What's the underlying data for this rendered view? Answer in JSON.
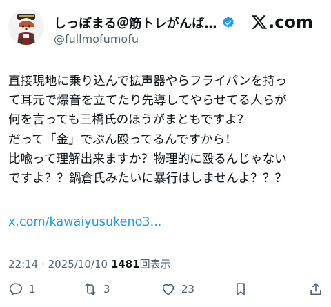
{
  "header": {
    "display_name": "しっぽまる＠筋トレがんば…",
    "handle": "@fullmofumofu",
    "brand": ".com",
    "verified_icon": "verified-badge-icon",
    "brand_icon": "x-logo-icon"
  },
  "post": {
    "lines": [
      "直接現地に乗り込んで拡声器やらフライパンを持っ",
      "て耳元で爆音を立てたり先導してやらせてる人らが",
      "何を言っても三橋氏のほうがまともですよ？",
      "だって「金」でぶん殴ってるんですから！",
      "比喩って理解出来ますか？物理的に殴るんじゃない",
      "ですよ？？鍋倉氏みたいに暴行はしませんよ？？？"
    ],
    "link": "x.com/kawaiyusukeno3..."
  },
  "meta": {
    "time": "22:14",
    "separator": "·",
    "date": "2025/10/10",
    "views_count": "1481",
    "views_label": "回表示"
  },
  "actions": {
    "reply_count": "1",
    "repost_count": "3",
    "like_count": "23"
  },
  "colors": {
    "text": "#0f1419",
    "secondary": "#536471",
    "link": "#1d9bf0",
    "verified": "#1d9bf0"
  }
}
